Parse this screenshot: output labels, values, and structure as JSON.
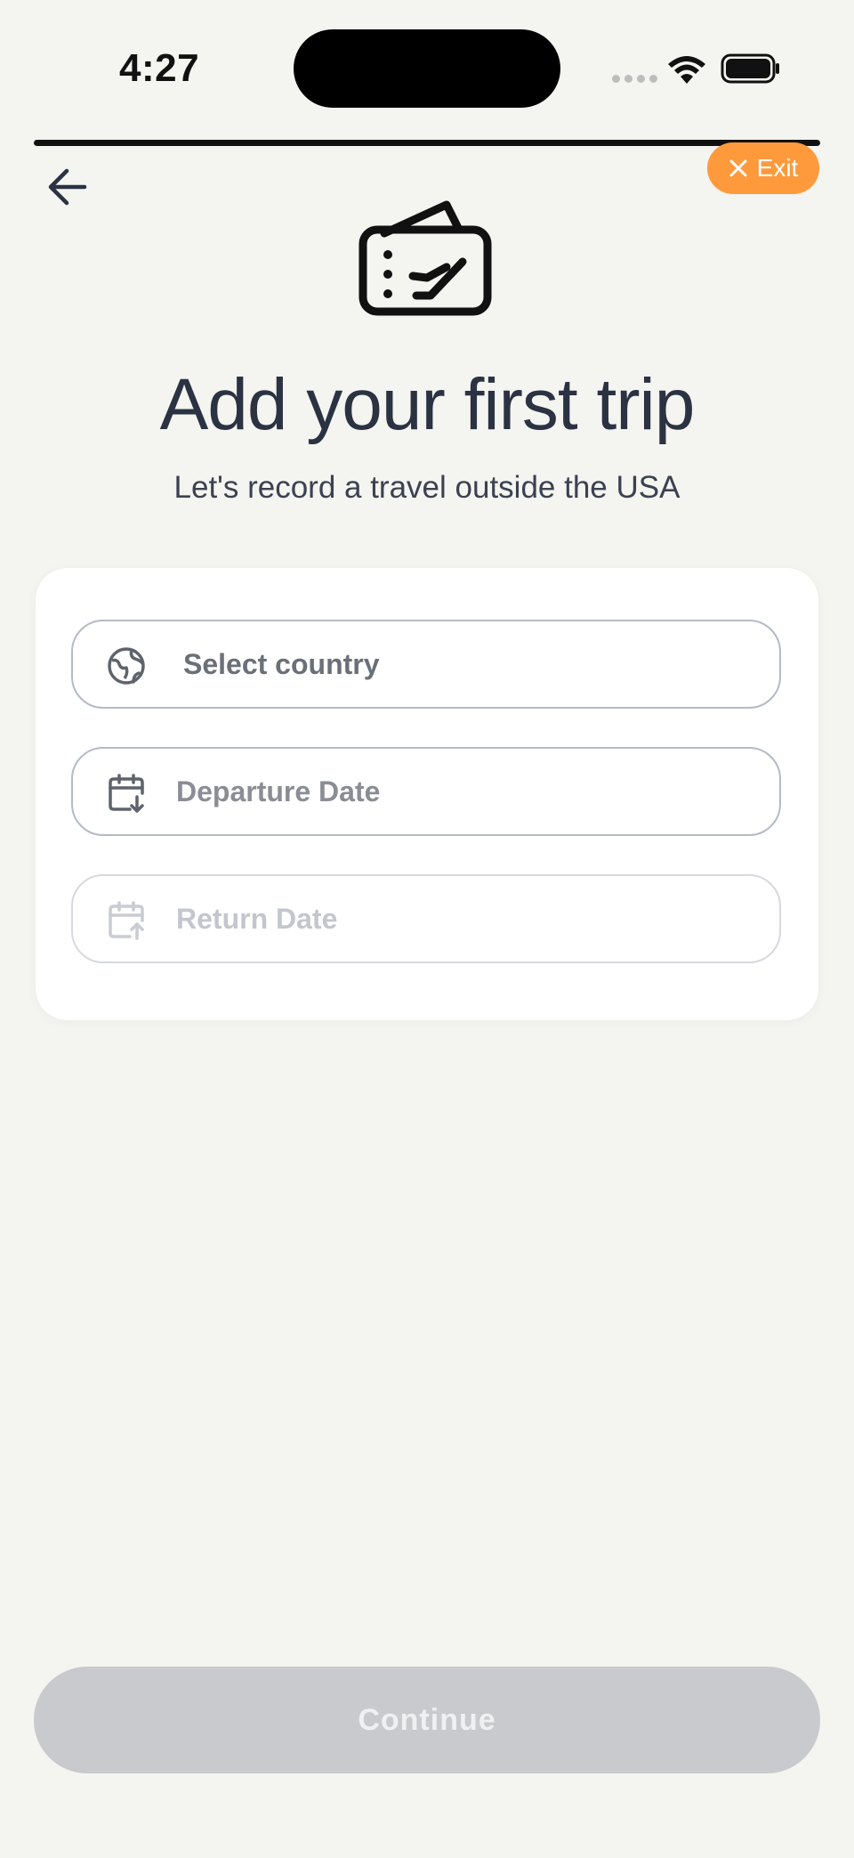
{
  "status_bar": {
    "time": "4:27",
    "icons": [
      "cellular-signal-icon",
      "wifi-icon",
      "battery-icon"
    ]
  },
  "header": {
    "back_icon": "arrow-left-icon",
    "exit_label": "Exit",
    "exit_icon": "close-icon"
  },
  "hero": {
    "icon": "plane-ticket-icon",
    "title": "Add your first trip",
    "subtitle": "Let's record a travel outside the USA"
  },
  "form": {
    "country": {
      "label": "Select country",
      "icon": "globe-icon"
    },
    "departure": {
      "label": "Departure Date",
      "icon": "calendar-arrow-down-icon"
    },
    "return": {
      "label": "Return Date",
      "icon": "calendar-arrow-up-icon"
    }
  },
  "footer": {
    "continue_label": "Continue"
  },
  "colors": {
    "background": "#f4f4f0",
    "accent": "#ff9a3c",
    "title": "#2b3242",
    "disabled_button": "#c8cacd"
  }
}
